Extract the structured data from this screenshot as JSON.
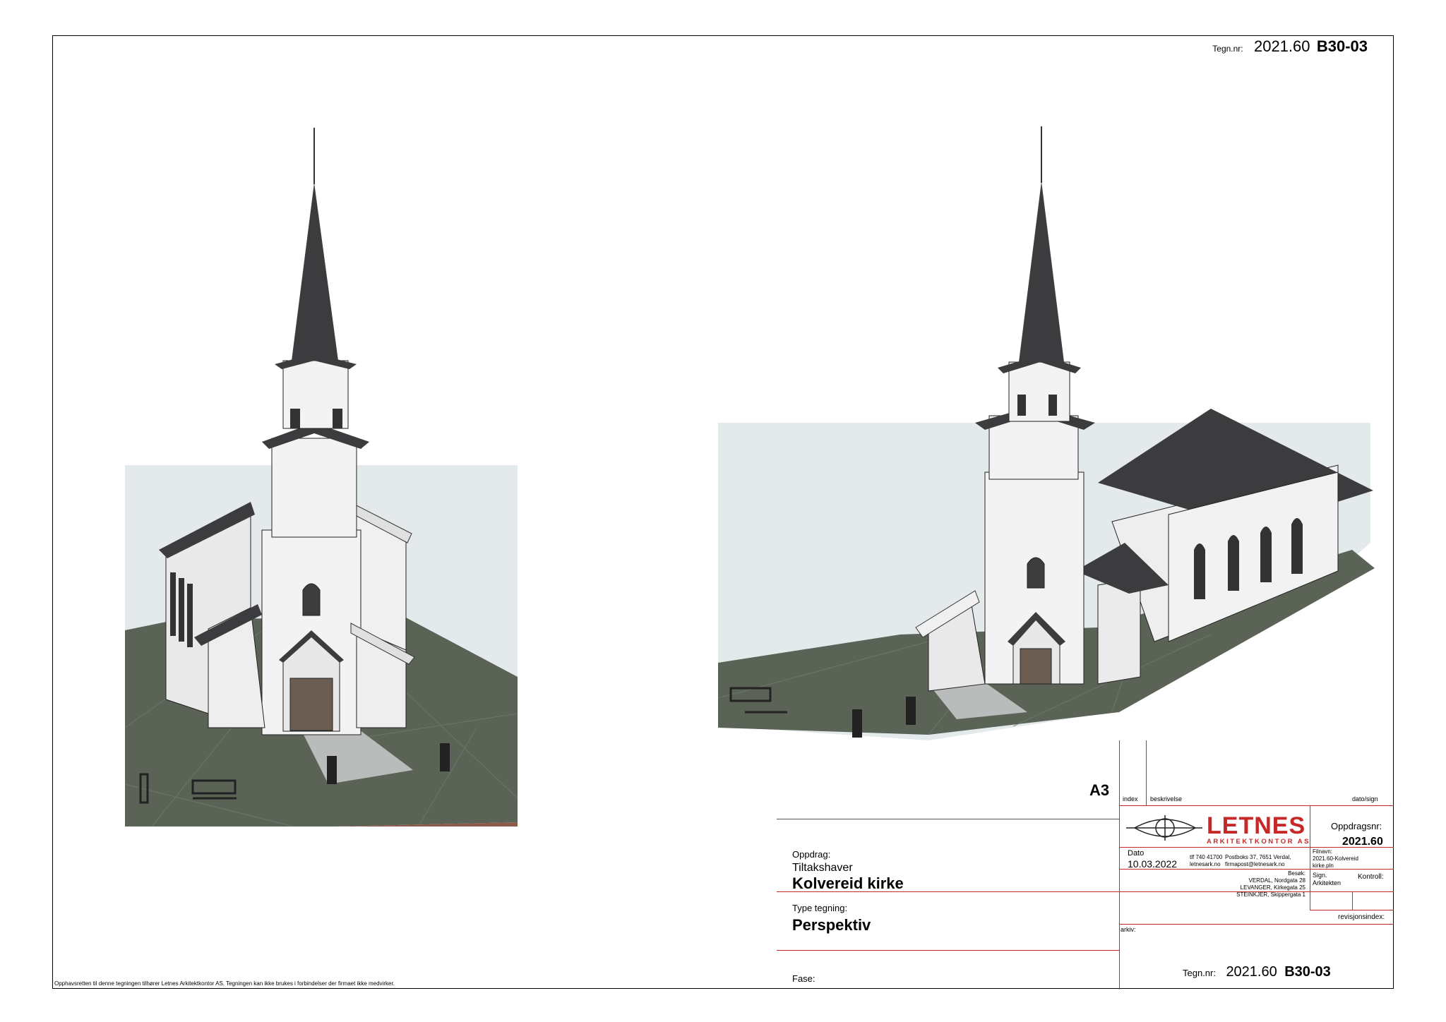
{
  "header": {
    "tegn_label": "Tegn.nr:",
    "tegn_number": "2021.60",
    "tegn_code": "B30-03"
  },
  "copyright": "Opphavsretten til denne tegningen tilhører Letnes Arkitektkontor AS. Tegningen kan ikke brukes i forbindelser der firmaet ikke medvirker.",
  "title_block": {
    "format": "A3",
    "col_index": "index",
    "col_description": "beskrivelse",
    "col_date_sign": "dato/sign",
    "oppdrag_label": "Oppdrag:",
    "tiltakshaver": "Tiltakshaver",
    "project_name": "Kolvereid kirke",
    "type_label": "Type tegning:",
    "type_value": "Perspektiv",
    "fase_label": "Fase:",
    "logo_name": "LETNES",
    "logo_sub": "ARKITEKTKONTOR AS",
    "oppdragsnr_label": "Oppdragsnr:",
    "oppdragsnr_value": "2021.60",
    "dato_label": "Dato",
    "dato_value": "10.03.2022",
    "tlf": "tlf 740 41700",
    "web": "letnesark.no",
    "postboks": "Postboks 37, 7651 Verdal,",
    "email": "firmapost@letnesark.no",
    "filnavn_label": "Filnavn:",
    "filnavn_value_1": "2021.60-Kolvereid",
    "filnavn_value_2": "kirke.pln",
    "besok_label": "Besøk:",
    "besok_1": "VERDAL, Nordgata 28",
    "besok_2": "LEVANGER, Kirkegata 25",
    "besok_3": "STEINKJER, Skippergata 1",
    "sign_label": "Sign.",
    "sign_value": "Arkitekten",
    "kontroll_label": "Kontroll:",
    "revisjonsindex_label": "revisjonsindex:",
    "arkiv_label": "arkiv:",
    "tegn_label": "Tegn.nr:",
    "tegn_number": "2021.60",
    "tegn_code": "B30-03"
  },
  "colors": {
    "frame_red": "#c62828",
    "roof": "#3c3c3e",
    "ground": "#5a6355",
    "sky": "#e4e9ec",
    "wall": "#f3f3f3"
  }
}
